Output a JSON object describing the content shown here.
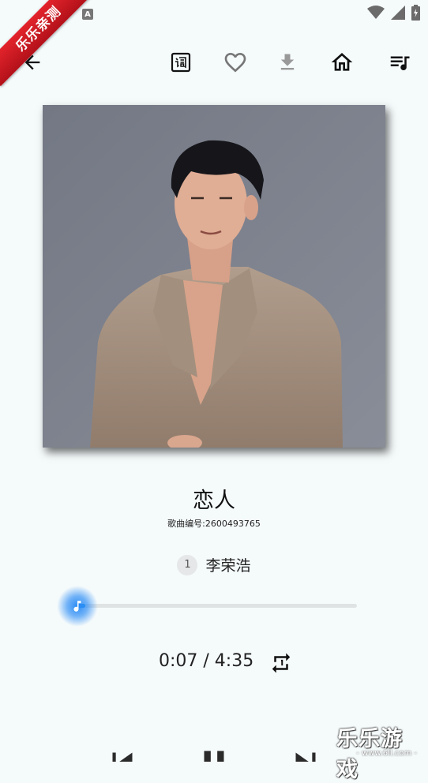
{
  "status_bar": {
    "notification_letter": "A"
  },
  "ribbon": {
    "text": "乐乐亲测"
  },
  "toolbar": {
    "back": "back-arrow-icon",
    "lyrics": "lyrics-icon",
    "favorite": "heart-icon",
    "download": "download-icon",
    "home": "home-icon",
    "queue": "playlist-icon"
  },
  "song": {
    "title": "恋人",
    "number_text": "歌曲编号:2600493765",
    "artist_index": "1",
    "artist": "李荣浩"
  },
  "playback": {
    "time_text": "0:07 / 4:35",
    "progress_fraction": 0.027,
    "repeat_icon": "repeat-icon",
    "accent_color": "#2196f3"
  },
  "controls": {
    "previous": "skip-previous-icon",
    "pause": "pause-icon",
    "next": "skip-next-icon"
  },
  "watermark": {
    "main": "乐乐游戏",
    "sub": "- www.6ll.com -"
  }
}
